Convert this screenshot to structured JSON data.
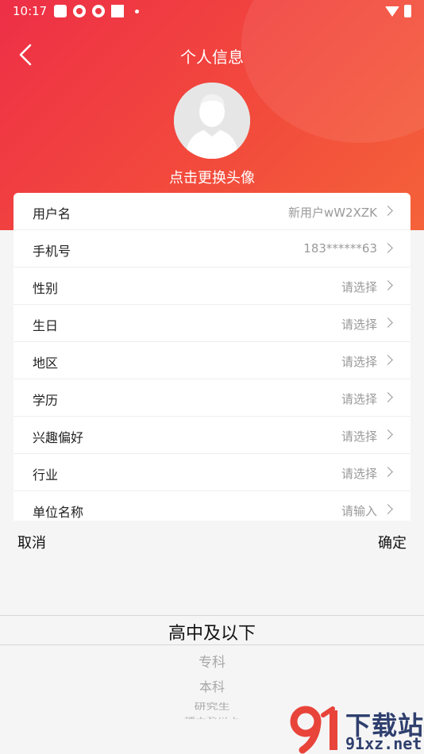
{
  "status_bar": {
    "time": "10:17"
  },
  "header": {
    "title": "个人信息",
    "avatar_caption": "点击更换头像"
  },
  "info_rows": [
    {
      "label": "用户名",
      "value": "新用户wW2XZK"
    },
    {
      "label": "手机号",
      "value": "183******63"
    },
    {
      "label": "性别",
      "value": "请选择"
    },
    {
      "label": "生日",
      "value": "请选择"
    },
    {
      "label": "地区",
      "value": "请选择"
    },
    {
      "label": "学历",
      "value": "请选择"
    },
    {
      "label": "兴趣偏好",
      "value": "请选择"
    },
    {
      "label": "行业",
      "value": "请选择"
    },
    {
      "label": "单位名称",
      "value": "请输入"
    }
  ],
  "picker": {
    "cancel_label": "取消",
    "confirm_label": "确定",
    "selected": "高中及以下",
    "options_below": [
      "专科",
      "本科",
      "研究生",
      "博士及以上"
    ]
  },
  "watermark": {
    "brand": "下载站",
    "domain": "91xz.net"
  },
  "colors": {
    "header_red": "#ee2f47",
    "header_orange": "#f4623a",
    "text_primary": "#222222",
    "text_secondary": "#9a9a9a",
    "watermark_red": "#e8443a",
    "watermark_navy": "#2f3f6e"
  }
}
